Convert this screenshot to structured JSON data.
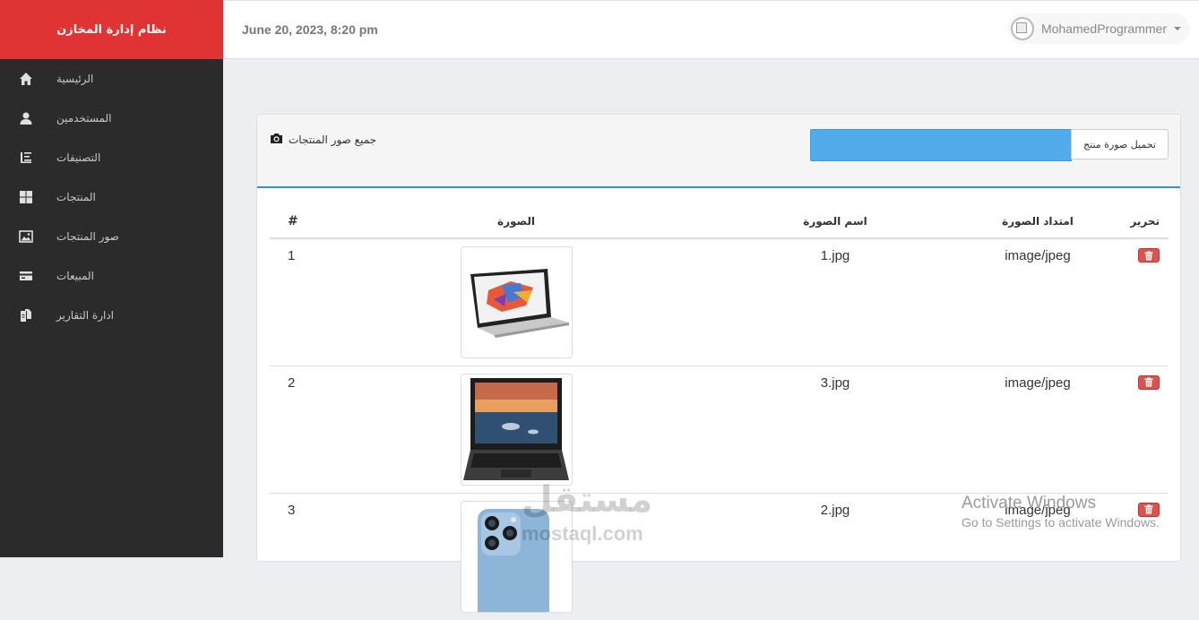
{
  "app": {
    "title": "نظام إدارة المخازن"
  },
  "sidebar": {
    "items": [
      {
        "label": "الرئيسية",
        "icon": "home-icon"
      },
      {
        "label": "المستخدمين",
        "icon": "user-icon"
      },
      {
        "label": "التصنيفات",
        "icon": "indent-icon"
      },
      {
        "label": "المنتجات",
        "icon": "grid-icon"
      },
      {
        "label": "صور المنتجات",
        "icon": "picture-icon"
      },
      {
        "label": "المبيعات",
        "icon": "credit-card-icon"
      },
      {
        "label": "ادارة التقارير",
        "icon": "copy-icon"
      }
    ]
  },
  "header": {
    "date": "June 20, 2023, 8:20 pm",
    "username": "MohamedProgrammer"
  },
  "panel": {
    "title": "جميع صور المنتجات",
    "upload_label": "تحميل صورة منتج"
  },
  "table": {
    "columns": {
      "num": "#",
      "image": "الصورة",
      "name": "اسم الصورة",
      "type": "امتداد الصورة",
      "edit": "تحرير"
    },
    "rows": [
      {
        "num": "1",
        "name": "1.jpg",
        "type": "image/jpeg",
        "image": "laptop-colorful-screen"
      },
      {
        "num": "2",
        "name": "3.jpg",
        "type": "image/jpeg",
        "image": "convertible-laptop-lake-screen"
      },
      {
        "num": "3",
        "name": "2.jpg",
        "type": "image/jpeg",
        "image": "iphone-blue"
      }
    ]
  },
  "watermark": {
    "arabic": "مستقل",
    "latin": "mostaql.com"
  },
  "os_notice": {
    "title": "Activate Windows",
    "subtitle": "Go to Settings to activate Windows."
  },
  "colors": {
    "brand": "#e03434",
    "sidebar": "#2b2b2b",
    "accent_line": "#3c8dbc",
    "upload_bar": "#52acea",
    "danger": "#d9534f"
  }
}
